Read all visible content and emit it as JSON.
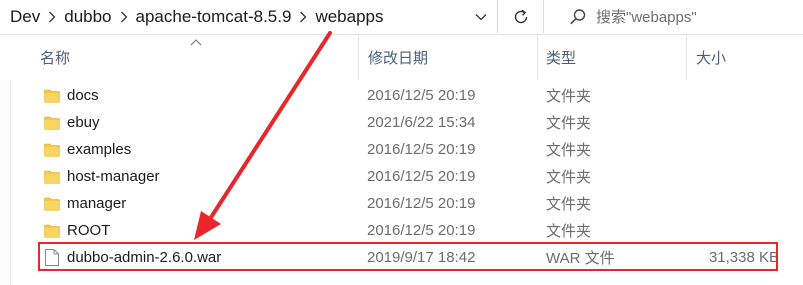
{
  "breadcrumb": [
    "Dev",
    "dubbo",
    "apache-tomcat-8.5.9",
    "webapps"
  ],
  "search": {
    "placeholder": "搜索\"webapps\""
  },
  "columns": {
    "name": "名称",
    "date": "修改日期",
    "type": "类型",
    "size": "大小"
  },
  "files": [
    {
      "name": "docs",
      "date": "2016/12/5 20:19",
      "type": "文件夹",
      "size": "",
      "icon": "folder-icon"
    },
    {
      "name": "ebuy",
      "date": "2021/6/22 15:34",
      "type": "文件夹",
      "size": "",
      "icon": "folder-icon"
    },
    {
      "name": "examples",
      "date": "2016/12/5 20:19",
      "type": "文件夹",
      "size": "",
      "icon": "folder-icon"
    },
    {
      "name": "host-manager",
      "date": "2016/12/5 20:19",
      "type": "文件夹",
      "size": "",
      "icon": "folder-icon"
    },
    {
      "name": "manager",
      "date": "2016/12/5 20:19",
      "type": "文件夹",
      "size": "",
      "icon": "folder-icon"
    },
    {
      "name": "ROOT",
      "date": "2016/12/5 20:19",
      "type": "文件夹",
      "size": "",
      "icon": "folder-icon"
    },
    {
      "name": "dubbo-admin-2.6.0.war",
      "date": "2019/9/17 18:42",
      "type": "WAR 文件",
      "size": "31,338 KB",
      "icon": "file-icon"
    }
  ],
  "colors": {
    "folder": "#f5c944",
    "annotation": "#e8262b",
    "header_text": "#4c607a"
  }
}
